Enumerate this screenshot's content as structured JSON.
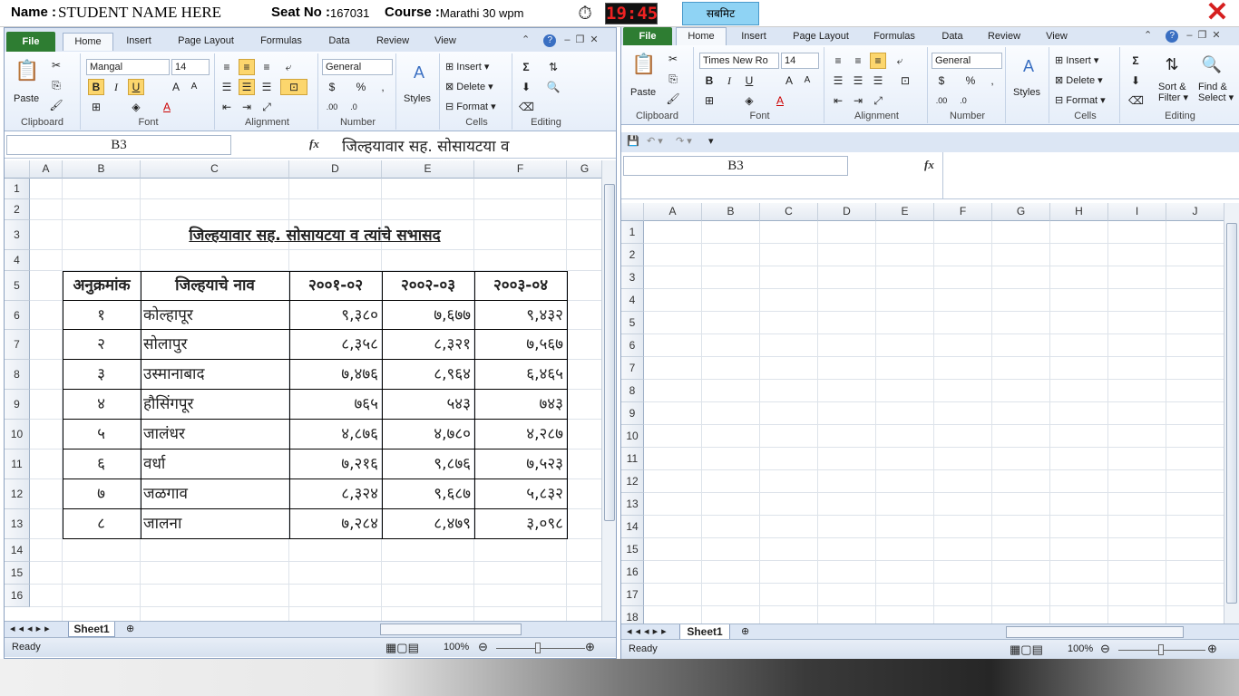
{
  "topbar": {
    "name_label": "Name :",
    "name_value": "STUDENT NAME HERE",
    "seat_label": "Seat No :",
    "seat_value": "167031",
    "course_label": "Course :",
    "course_value": "Marathi 30 wpm",
    "timer": "19:45",
    "submit_label": "सबमिट"
  },
  "ribbon_tabs": [
    "File",
    "Home",
    "Insert",
    "Page Layout",
    "Formulas",
    "Data",
    "Review",
    "View"
  ],
  "left": {
    "font_name": "Mangal",
    "font_size": "14",
    "number_format": "General",
    "groups": [
      "Clipboard",
      "Font",
      "Alignment",
      "Number",
      "Cells",
      "Editing"
    ],
    "paste": "Paste",
    "styles": "Styles",
    "insert": "Insert",
    "delete": "Delete",
    "format": "Format",
    "name_box": "B3",
    "formula": "जिल्हयावार सह. सोसायटया व",
    "columns": [
      "A",
      "B",
      "C",
      "D",
      "E",
      "F",
      "G"
    ],
    "rows": [
      "1",
      "2",
      "3",
      "4",
      "5",
      "6",
      "7",
      "8",
      "9",
      "10",
      "11",
      "12",
      "13",
      "14",
      "15",
      "16"
    ],
    "title": "जिल्हयावार सह. सोसायटया व त्यांचे सभासद",
    "table_headers": [
      "अनुक्रमांक",
      "जिल्हयाचे नाव",
      "२००१-०२",
      "२००२-०३",
      "२००३-०४"
    ],
    "table_rows": [
      [
        "१",
        "कोल्हापूर",
        "९,३८०",
        "७,६७७",
        "९,४३२"
      ],
      [
        "२",
        "सोलापुर",
        "८,३५८",
        "८,३२१",
        "७,५६७"
      ],
      [
        "३",
        "उस्मानाबाद",
        "७,४७६",
        "८,९६४",
        "६,४६५"
      ],
      [
        "४",
        "हौसिंगपूर",
        "७६५",
        "५४३",
        "७४३"
      ],
      [
        "५",
        "जालंधर",
        "४,८७६",
        "४,७८०",
        "४,२८७"
      ],
      [
        "६",
        "वर्धा",
        "७,२१६",
        "९,८७६",
        "७,५२३"
      ],
      [
        "७",
        "जळगाव",
        "८,३२४",
        "९,६८७",
        "५,८३२"
      ],
      [
        "८",
        "जालना",
        "७,२८४",
        "८,४७९",
        "३,०९८"
      ]
    ],
    "sheet_tab": "Sheet1",
    "status": "Ready",
    "zoom": "100%"
  },
  "right": {
    "font_name": "Times New Ro",
    "font_size": "14",
    "number_format": "General",
    "groups": [
      "Clipboard",
      "Font",
      "Alignment",
      "Number",
      "Cells",
      "Editing"
    ],
    "paste": "Paste",
    "styles": "Styles",
    "insert": "Insert",
    "delete": "Delete",
    "format": "Format",
    "sort": "Sort &",
    "filter": "Filter",
    "find": "Find &",
    "select": "Select",
    "name_box": "B3",
    "columns": [
      "A",
      "B",
      "C",
      "D",
      "E",
      "F",
      "G",
      "H",
      "I",
      "J"
    ],
    "rows": [
      "1",
      "2",
      "3",
      "4",
      "5",
      "6",
      "7",
      "8",
      "9",
      "10",
      "11",
      "12",
      "13",
      "14",
      "15",
      "16",
      "17",
      "18"
    ],
    "sheet_tab": "Sheet1",
    "status": "Ready",
    "zoom": "100%"
  },
  "icons": [
    "stopwatch-icon",
    "close-icon",
    "help-icon",
    "fx-icon",
    "save-icon",
    "undo-icon",
    "redo-icon"
  ],
  "colors": {
    "file_tab": "#2e7d32",
    "timer_text": "#e22222",
    "submit_bg": "#8fd3f4",
    "close": "#d61f1f",
    "selected": "#fcd66d"
  }
}
